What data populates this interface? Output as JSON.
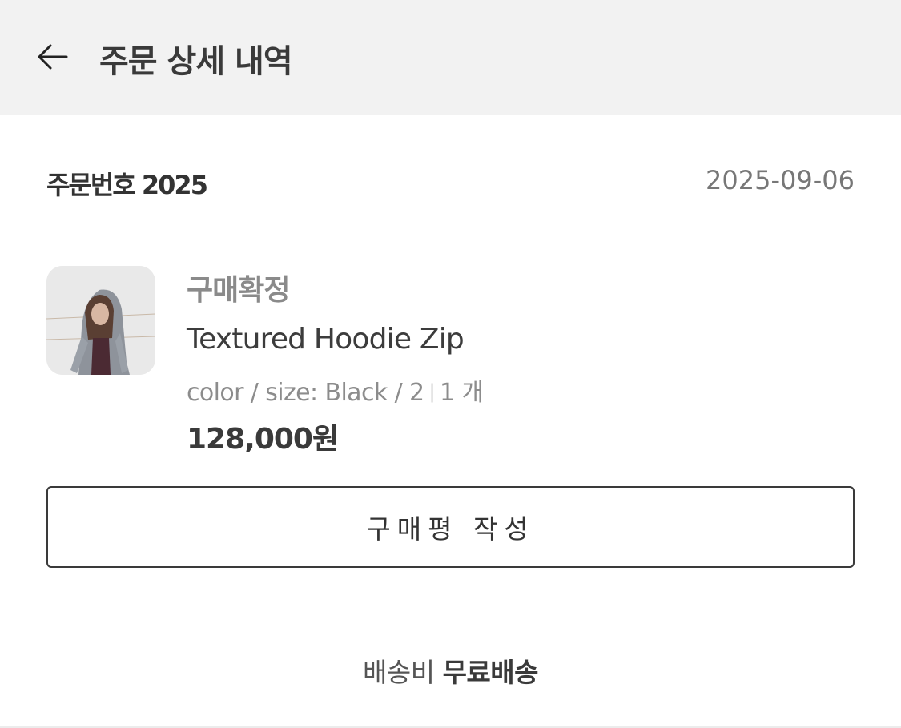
{
  "header": {
    "title": "주문 상세 내역",
    "back_icon": "arrow-left-icon"
  },
  "order": {
    "number_label": "주문번호 2025",
    "date": "2025-09-06"
  },
  "item": {
    "status": "구매확정",
    "name": "Textured Hoodie Zip",
    "options": "color / size: Black / 2",
    "quantity": "1 개",
    "price": "128,000원"
  },
  "actions": {
    "review_label": "구매평 작성"
  },
  "shipping": {
    "label": "배송비",
    "value": "무료배송"
  }
}
